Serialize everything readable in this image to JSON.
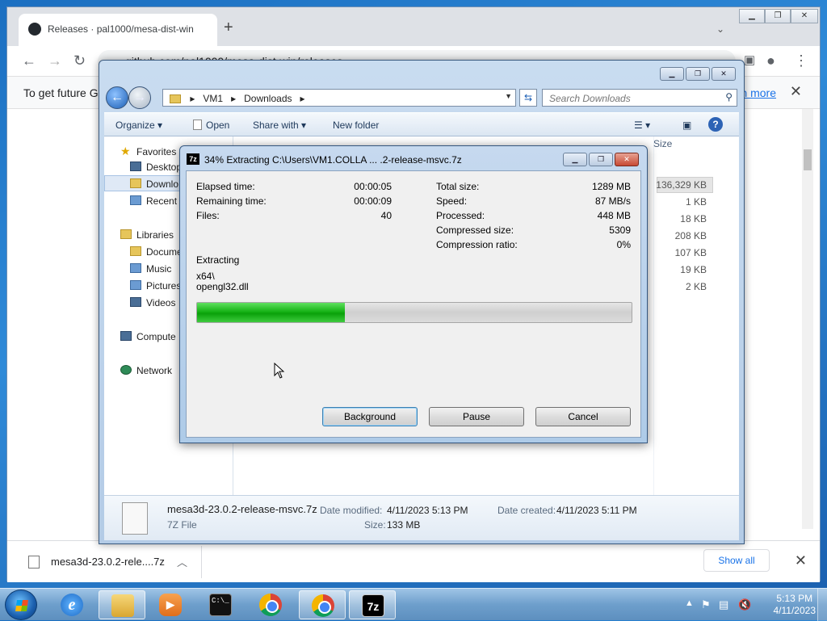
{
  "chrome": {
    "tab_title": "Releases · pal1000/mesa-dist-win",
    "url": "github.com/pal1000/mesa-dist-win/releases",
    "infobar_text": "To get future Go",
    "infobar_link": "n more",
    "download_file": "mesa3d-23.0.2-rele....7z",
    "show_all": "Show all"
  },
  "explorer": {
    "breadcrumb": [
      "VM1",
      "Downloads"
    ],
    "search_placeholder": "Search Downloads",
    "commands": [
      "Organize",
      "Open",
      "Share with",
      "New folder"
    ],
    "size_header": "Size",
    "sizes": [
      "136,329 KB",
      "1 KB",
      "18 KB",
      "208 KB",
      "107 KB",
      "19 KB",
      "2 KB"
    ],
    "nav": {
      "favorites": "Favorites",
      "desktop": "Desktop",
      "downloads": "Downlo",
      "recent": "Recent I",
      "libraries": "Libraries",
      "documents": "Docume",
      "music": "Music",
      "pictures": "Pictures",
      "videos": "Videos",
      "computer": "Compute",
      "network": "Network"
    },
    "details": {
      "filename": "mesa3d-23.0.2-release-msvc.7z",
      "filetype": "7Z File",
      "modified_label": "Date modified:",
      "modified_value": "4/11/2023 5:13 PM",
      "created_label": "Date created:",
      "created_value": "4/11/2023 5:11 PM",
      "size_label": "Size:",
      "size_value": "133 MB"
    }
  },
  "sevenzip": {
    "title": "34% Extracting C:\\Users\\VM1.COLLA ... .2-release-msvc.7z",
    "progress_percent": 34,
    "elapsed_label": "Elapsed time:",
    "elapsed_value": "00:00:05",
    "remaining_label": "Remaining time:",
    "remaining_value": "00:00:09",
    "files_label": "Files:",
    "files_value": "40",
    "total_label": "Total size:",
    "total_value": "1289 MB",
    "speed_label": "Speed:",
    "speed_value": "87 MB/s",
    "processed_label": "Processed:",
    "processed_value": "448 MB",
    "compressed_label": "Compressed size:",
    "compressed_value": "5309",
    "ratio_label": "Compression ratio:",
    "ratio_value": "0%",
    "status": "Extracting",
    "current_dir": "x64\\",
    "current_file": "opengl32.dll",
    "buttons": {
      "background": "Background",
      "pause": "Pause",
      "cancel": "Cancel"
    }
  },
  "taskbar": {
    "time": "5:13 PM",
    "date": "4/11/2023",
    "apps": [
      "internet-explorer",
      "windows-explorer",
      "media-player",
      "command-prompt",
      "chrome",
      "chrome",
      "7-zip"
    ],
    "seven_zip_label": "7z",
    "cmd_label": "C:\\_"
  }
}
